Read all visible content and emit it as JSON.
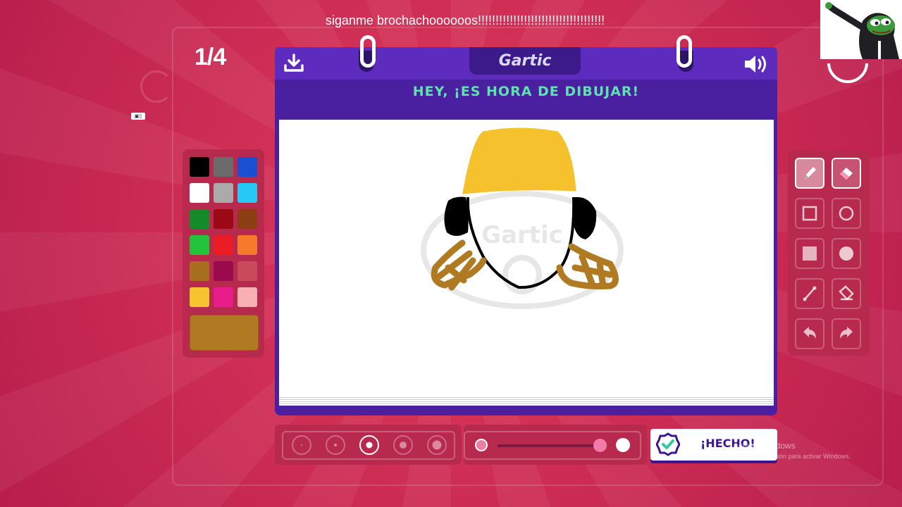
{
  "caption": "siganme brochachoooooos!!!!!!!!!!!!!!!!!!!!!!!!!!!!!!!!!!!!",
  "round_counter": "1/4",
  "app": {
    "logo_text": "Gartic",
    "title": "HEY, ¡ES HORA DE DIBUJAR!"
  },
  "header_icons": {
    "download": "download-icon",
    "sound": "speaker-icon"
  },
  "palette": {
    "colors": [
      "#000000",
      "#6b6b6b",
      "#1a4fd1",
      "#ffffff",
      "#aaaaaa",
      "#28c8f5",
      "#148a2a",
      "#9b0a14",
      "#8c3d14",
      "#22c43c",
      "#ec1c24",
      "#f77a2c",
      "#a8701e",
      "#9a0a4d",
      "#c94b5a",
      "#f7c430",
      "#e81c8a",
      "#f9b0b4"
    ],
    "selected_color": "#b07a22"
  },
  "tools": [
    {
      "name": "pencil-tool",
      "icon": "pencil-icon",
      "active": true
    },
    {
      "name": "eraser-tool",
      "icon": "eraser-icon",
      "active": false
    },
    {
      "name": "rectangle-tool",
      "icon": "square-outline-icon",
      "active": false
    },
    {
      "name": "ellipse-tool",
      "icon": "circle-outline-icon",
      "active": false
    },
    {
      "name": "filled-rectangle-tool",
      "icon": "square-filled-icon",
      "active": false
    },
    {
      "name": "filled-ellipse-tool",
      "icon": "circle-filled-icon",
      "active": false
    },
    {
      "name": "line-tool",
      "icon": "line-icon",
      "active": false
    },
    {
      "name": "fill-tool",
      "icon": "bucket-icon",
      "active": false
    },
    {
      "name": "undo-tool",
      "icon": "undo-icon",
      "active": false
    },
    {
      "name": "redo-tool",
      "icon": "redo-icon",
      "active": false
    }
  ],
  "brush_sizes": {
    "count": 5,
    "selected_index": 2
  },
  "opacity": {
    "value": 1.0
  },
  "done_button": {
    "label": "¡HECHO!"
  },
  "windows_watermark": {
    "line1": "Activar Windows",
    "line2": "Ve a Configuración para activar Windows."
  },
  "canvas_watermark": "Gartic"
}
